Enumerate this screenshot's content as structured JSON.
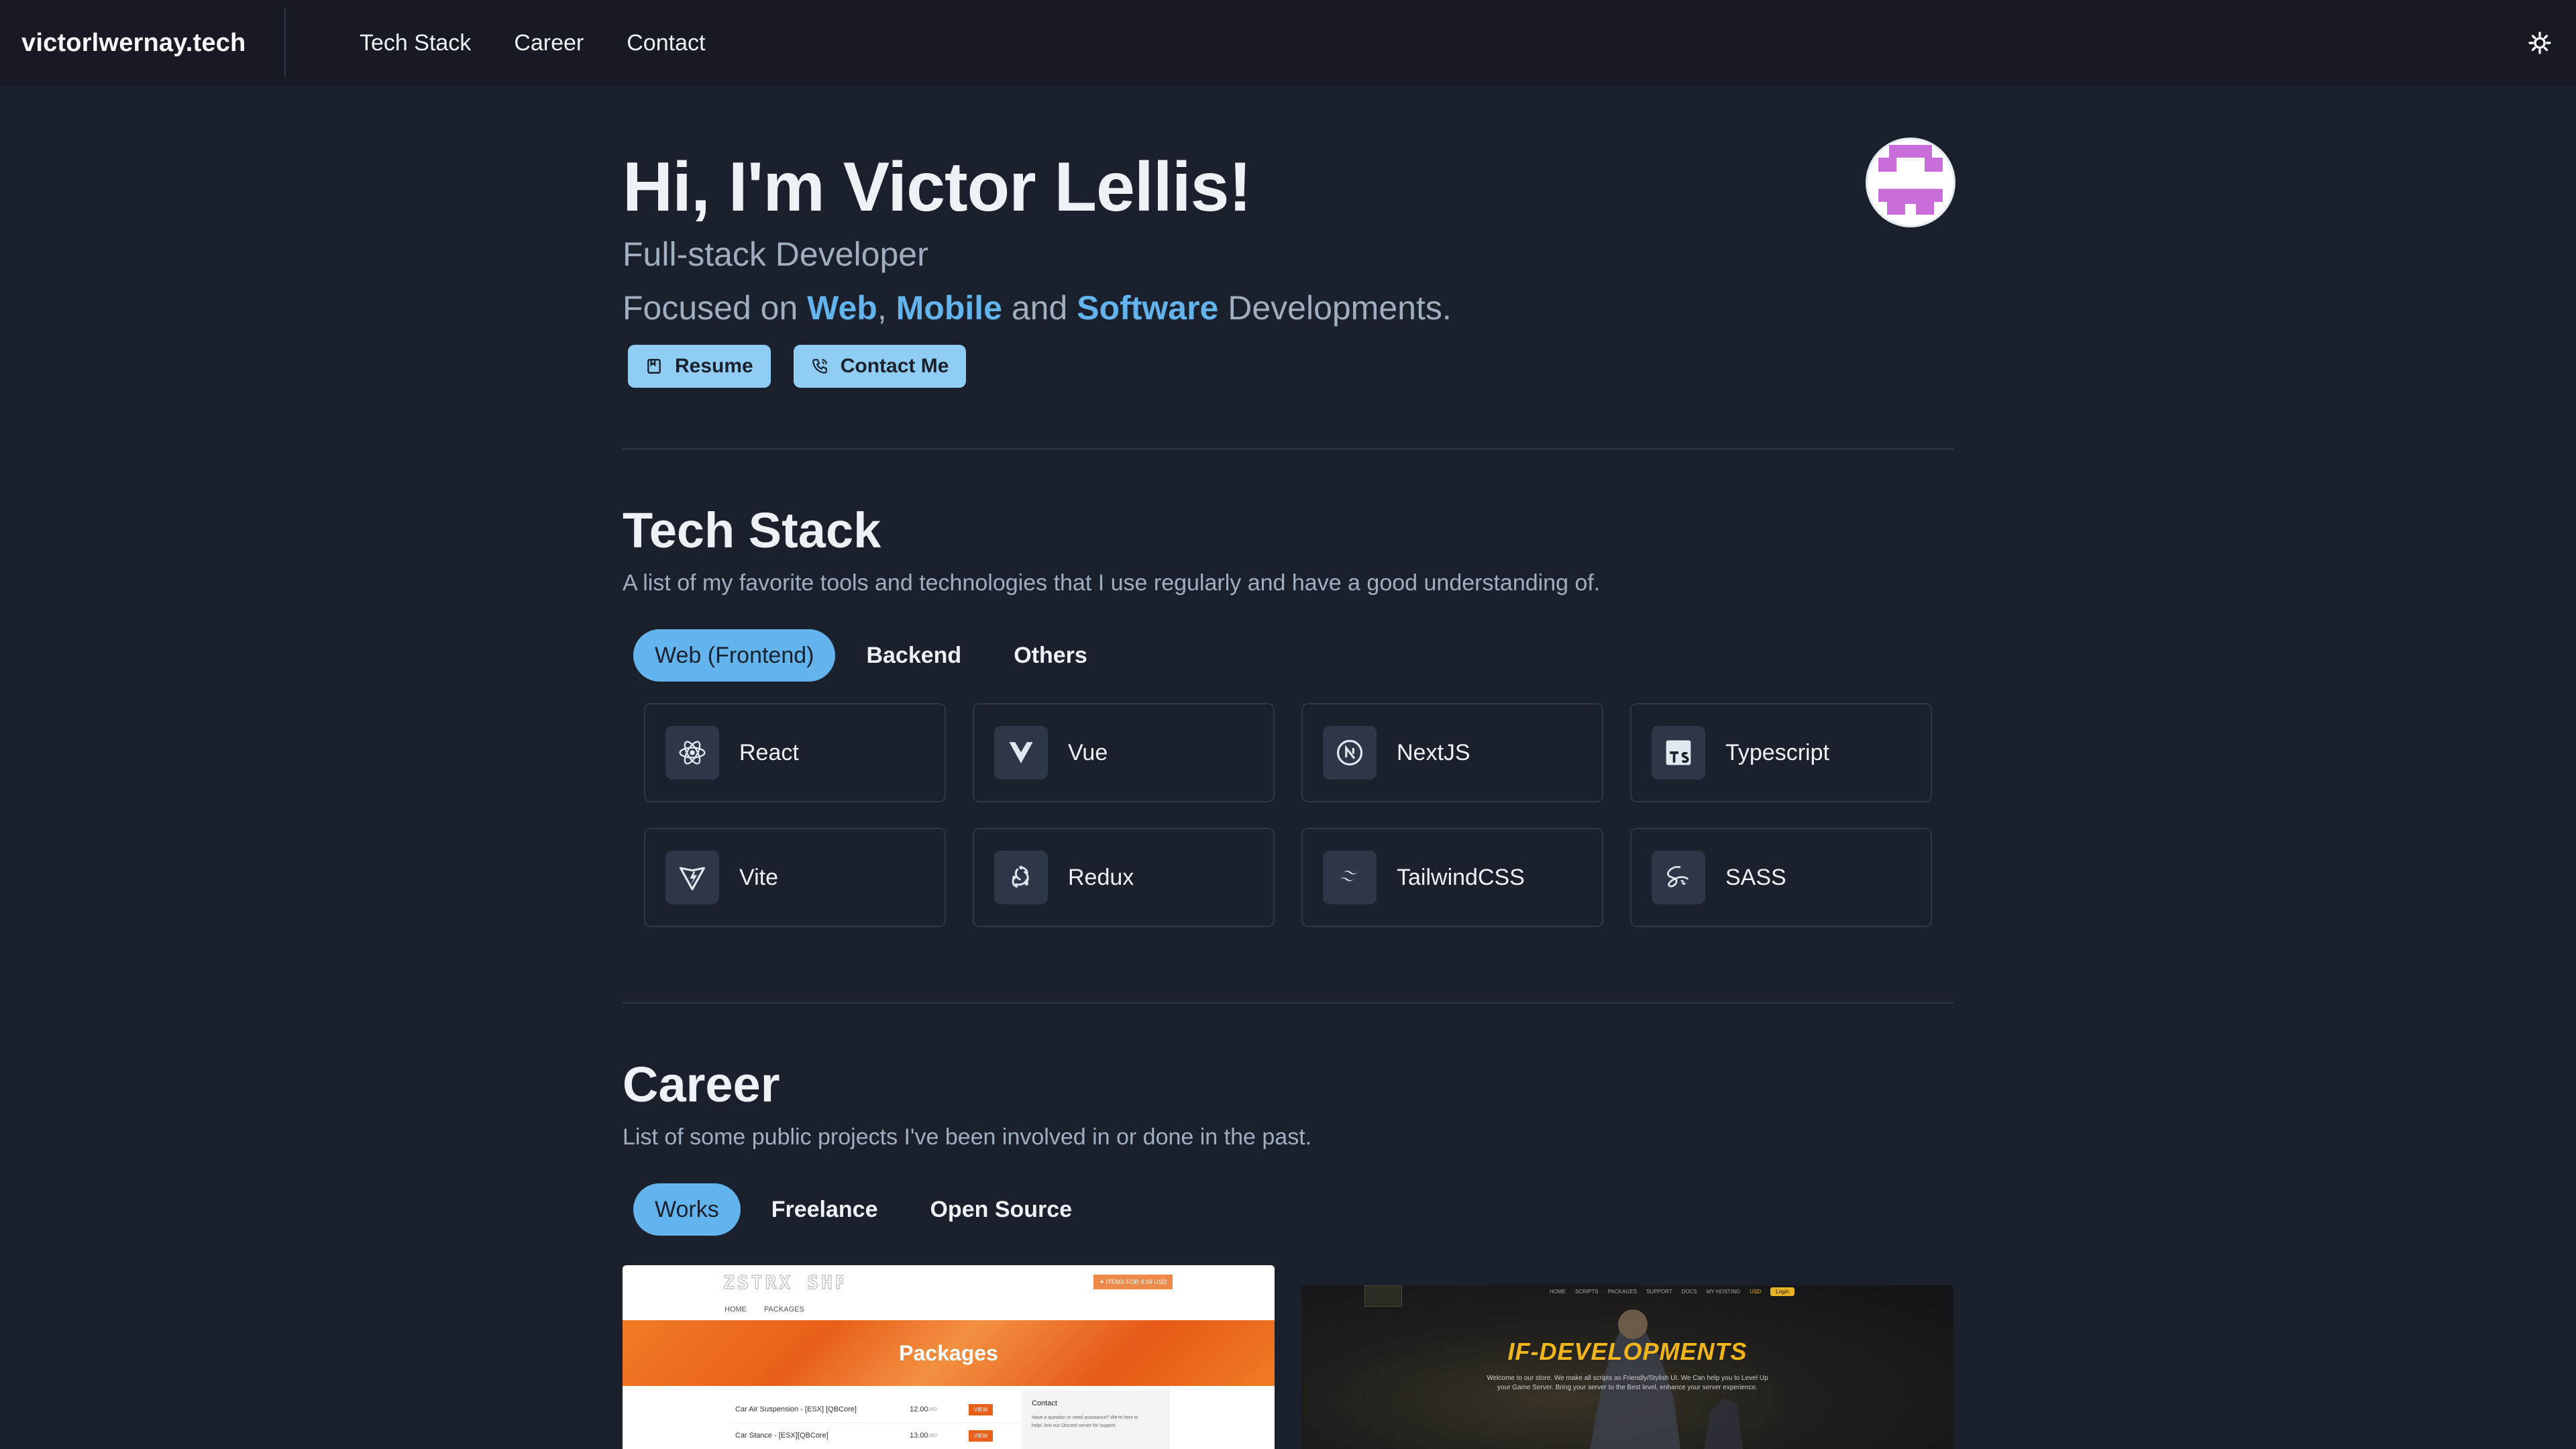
{
  "nav": {
    "brand": "victorlwernay.tech",
    "links": [
      "Tech Stack",
      "Career",
      "Contact"
    ],
    "theme_icon": "sun-icon"
  },
  "hero": {
    "greeting": "Hi, I'm Victor Lellis!",
    "role": "Full-stack Developer",
    "focus": {
      "prefix": "Focused on ",
      "web": "Web",
      "comma": ",",
      "mobile": "Mobile",
      "and": " and ",
      "software": "Software",
      "suffix": " Developments."
    },
    "buttons": {
      "resume": "Resume",
      "contact": "Contact Me"
    }
  },
  "tech_stack": {
    "title": "Tech Stack",
    "description": "A list of my favorite tools and technologies that I use regularly and have a good understanding of.",
    "tabs": [
      "Web (Frontend)",
      "Backend",
      "Others"
    ],
    "active_tab": "Web (Frontend)",
    "items": [
      {
        "label": "React",
        "icon": "react-icon"
      },
      {
        "label": "Vue",
        "icon": "vue-icon"
      },
      {
        "label": "NextJS",
        "icon": "nextjs-icon"
      },
      {
        "label": "Typescript",
        "icon": "typescript-icon"
      },
      {
        "label": "Vite",
        "icon": "vite-icon"
      },
      {
        "label": "Redux",
        "icon": "redux-icon"
      },
      {
        "label": "TailwindCSS",
        "icon": "tailwind-icon"
      },
      {
        "label": "SASS",
        "icon": "sass-icon"
      }
    ]
  },
  "career": {
    "title": "Career",
    "description": "List of some public projects I've been involved in or done in the past.",
    "tabs": [
      "Works",
      "Freelance",
      "Open Source"
    ],
    "active_tab": "Works",
    "project1": {
      "header_button": "✦ ITEMS FOR 9.99 USD",
      "nav": [
        "HOME",
        "PACKAGES"
      ],
      "banner": "Packages",
      "rows": [
        {
          "name": "Car Air Suspension - [ESX] [QBCore]",
          "price": "12.00",
          "currency": "USD",
          "button": "VIEW"
        },
        {
          "name": "Car Stance - [ESX][QBCore]",
          "price": "13.00",
          "currency": "USD",
          "button": "VIEW"
        }
      ],
      "contact_title": "Contact",
      "contact_text": "Have a question or need assistance? We're here to help! Join our Discord server for support."
    },
    "project2": {
      "nav": [
        "HOME",
        "SCRIPTS",
        "PACKAGES",
        "SUPPORT",
        "DOCS",
        "MY HOSTING",
        "USD",
        "Login"
      ],
      "title": "IF-DEVELOPMENTS",
      "tagline": "Welcome to our store. We make all scripts as Friendly/Stylish UI. We Can help you to Level Up your Game Server. Bring your server to the Best level, enhance your server experience."
    }
  },
  "colors": {
    "background": "#1a202c",
    "navbar": "#171923",
    "accent": "#63b3ed",
    "button": "#90cdf4"
  }
}
